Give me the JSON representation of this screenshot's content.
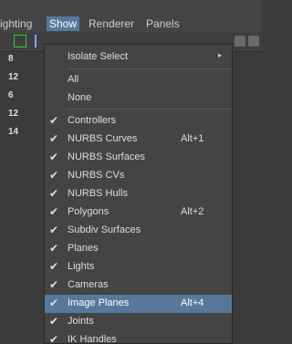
{
  "menubar": {
    "items": [
      {
        "label": "ighting"
      },
      {
        "label": "Show",
        "active": true
      },
      {
        "label": "Renderer"
      },
      {
        "label": "Panels"
      }
    ]
  },
  "viewport": {
    "numbers": [
      "8",
      "12",
      "6",
      "12",
      "14"
    ]
  },
  "show_menu": {
    "items": [
      {
        "label": "Isolate Select",
        "checked": false,
        "shortcut": "",
        "submenu_arrow": "▸"
      },
      {
        "label": "All",
        "checked": false,
        "shortcut": ""
      },
      {
        "label": "None",
        "checked": false,
        "shortcut": ""
      },
      {
        "label": "Controllers",
        "checked": true,
        "shortcut": ""
      },
      {
        "label": "NURBS Curves",
        "checked": true,
        "shortcut": "Alt+1"
      },
      {
        "label": "NURBS Surfaces",
        "checked": true,
        "shortcut": ""
      },
      {
        "label": "NURBS CVs",
        "checked": true,
        "shortcut": ""
      },
      {
        "label": "NURBS Hulls",
        "checked": true,
        "shortcut": ""
      },
      {
        "label": "Polygons",
        "checked": true,
        "shortcut": "Alt+2"
      },
      {
        "label": "Subdiv Surfaces",
        "checked": true,
        "shortcut": ""
      },
      {
        "label": "Planes",
        "checked": true,
        "shortcut": ""
      },
      {
        "label": "Lights",
        "checked": true,
        "shortcut": ""
      },
      {
        "label": "Cameras",
        "checked": true,
        "shortcut": ""
      },
      {
        "label": "Image Planes",
        "checked": true,
        "shortcut": "Alt+4",
        "highlighted": true
      },
      {
        "label": "Joints",
        "checked": true,
        "shortcut": ""
      },
      {
        "label": "IK Handles",
        "checked": true,
        "shortcut": ""
      }
    ],
    "check_glyph": "✔"
  },
  "colors": {
    "highlight": "#56789a",
    "menu_bg": "#444444",
    "text": "#dddddd"
  }
}
